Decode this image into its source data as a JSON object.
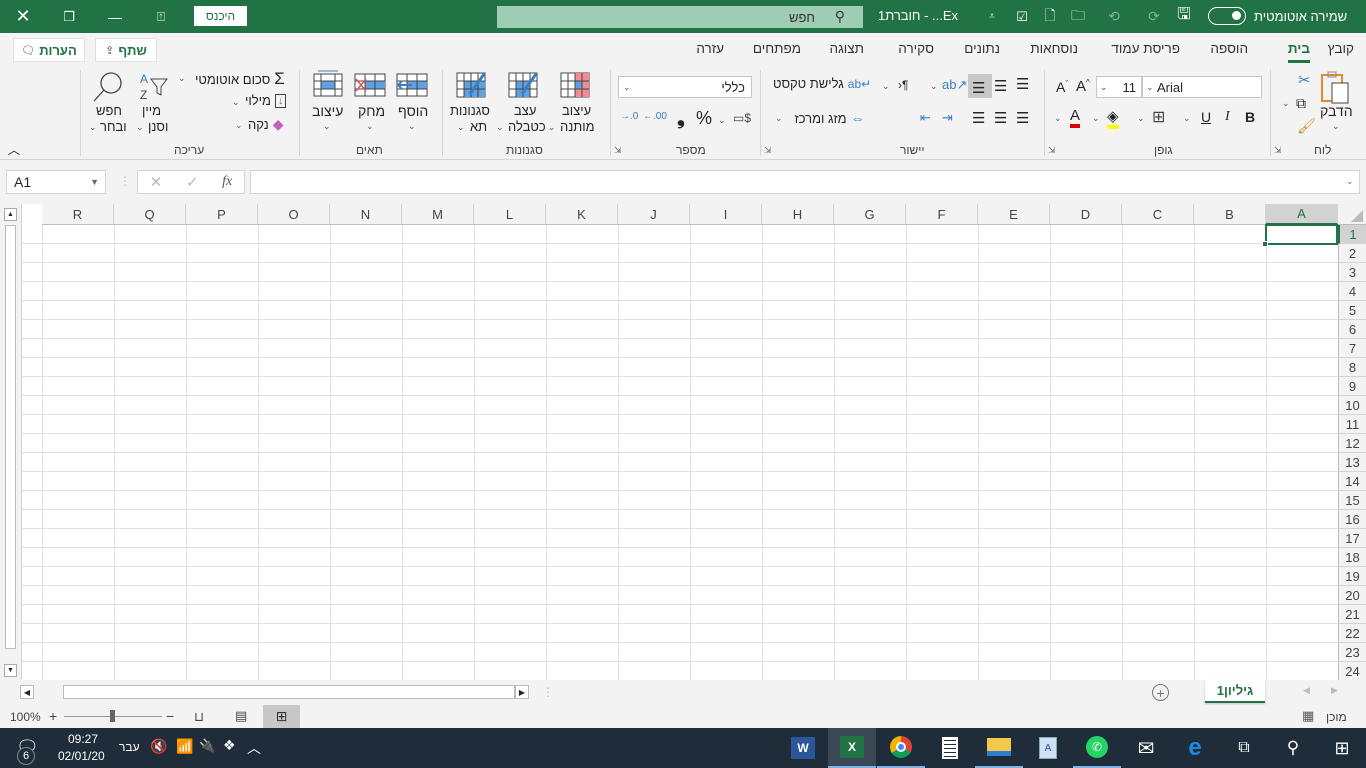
{
  "titlebar": {
    "autosave_label": "שמירה אוטומטית",
    "doc_title": "חוברת1 - ...Ex",
    "search_placeholder": "חפש",
    "signin_label": "היכנס"
  },
  "ribbon_tabs": [
    "קובץ",
    "בית",
    "הוספה",
    "פריסת עמוד",
    "נוסחאות",
    "נתונים",
    "סקירה",
    "תצוגה",
    "מפתחים",
    "עזרה"
  ],
  "active_tab": "בית",
  "share_label": "שתף",
  "comments_label": "הערות",
  "ribbon": {
    "clipboard": {
      "label": "לוח",
      "paste": "הדבק"
    },
    "font": {
      "label": "גופן",
      "font_name": "Arial",
      "font_size": "11",
      "bold": "B",
      "italic": "I",
      "underline": "U"
    },
    "alignment": {
      "label": "יישור",
      "wrap_text": "גלישת טקסט",
      "merge_center": "מזג ומרכז"
    },
    "number": {
      "label": "מספר",
      "format": "כללי",
      "percent": "%",
      "comma": "9"
    },
    "styles": {
      "label": "סגנונות",
      "conditional_1": "עיצוב",
      "conditional_2": "מותנה",
      "table_1": "עצב",
      "table_2": "כטבלה",
      "cell_1": "סגנונות",
      "cell_2": "תא"
    },
    "cells": {
      "label": "תאים",
      "insert": "הוסף",
      "delete": "מחק",
      "format": "עיצוב"
    },
    "editing": {
      "label": "עריכה",
      "autosum": "סכום אוטומטי",
      "fill": "מילוי",
      "clear": "נקה",
      "sort_1": "מיין",
      "sort_2": "וסנן",
      "find_1": "חפש",
      "find_2": "ובחר"
    }
  },
  "formula_bar": {
    "name_box": "A1",
    "fx": "fx",
    "formula": ""
  },
  "grid": {
    "columns": [
      "A",
      "B",
      "C",
      "D",
      "E",
      "F",
      "G",
      "H",
      "I",
      "J",
      "K",
      "L",
      "M",
      "N",
      "O",
      "P",
      "Q",
      "R"
    ],
    "rows": [
      "1",
      "2",
      "3",
      "4",
      "5",
      "6",
      "7",
      "8",
      "9",
      "10",
      "11",
      "12",
      "13",
      "14",
      "15",
      "16",
      "17",
      "18",
      "19",
      "20",
      "21",
      "22",
      "23",
      "24"
    ],
    "selected_cell": "A1"
  },
  "sheets": [
    {
      "name": "גיליון1",
      "active": true
    }
  ],
  "statusbar": {
    "status": "מוכן",
    "zoom": "100%"
  },
  "taskbar": {
    "time": "09:27",
    "date": "02/01/20",
    "language": "עבר",
    "notifications": "6",
    "apps": [
      "Word",
      "Excel",
      "Chrome",
      "Calculator",
      "File Explorer",
      "WordPad",
      "WhatsApp",
      "Mail",
      "Edge",
      "Task View",
      "Search",
      "Start"
    ]
  },
  "colors": {
    "accent": "#217346",
    "taskbar": "#1f2d3a"
  }
}
